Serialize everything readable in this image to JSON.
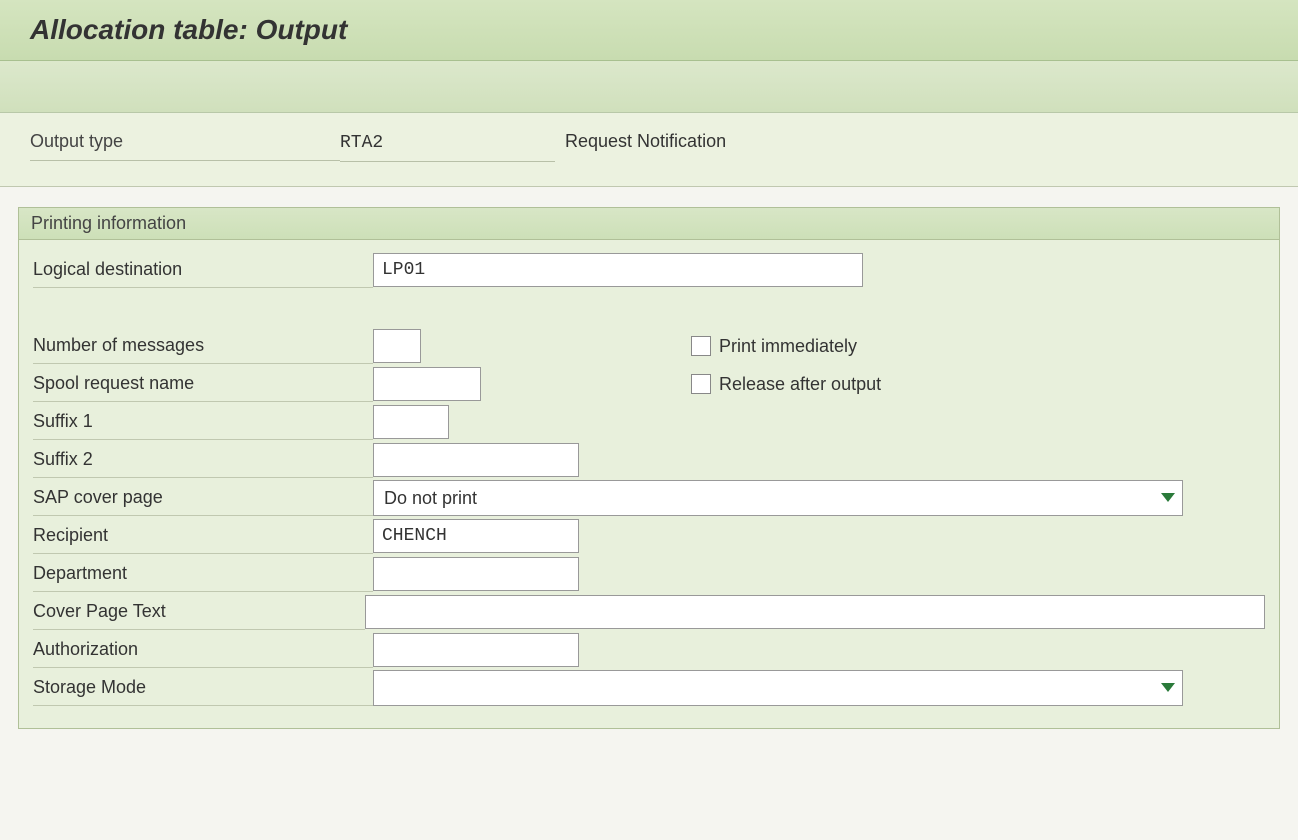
{
  "header": {
    "title": "Allocation table: Output"
  },
  "info": {
    "output_type_label": "Output type",
    "output_type_value": "RTA2",
    "output_type_desc": "Request Notification"
  },
  "group": {
    "title": "Printing information",
    "fields": {
      "logical_destination_label": "Logical destination",
      "logical_destination_value": "LP01",
      "number_of_messages_label": "Number of messages",
      "number_of_messages_value": "",
      "print_immediately_label": "Print immediately",
      "spool_request_name_label": "Spool request name",
      "spool_request_name_value": "",
      "release_after_output_label": "Release after output",
      "suffix1_label": "Suffix 1",
      "suffix1_value": "",
      "suffix2_label": "Suffix 2",
      "suffix2_value": "",
      "sap_cover_page_label": "SAP cover page",
      "sap_cover_page_value": "Do not print",
      "recipient_label": "Recipient",
      "recipient_value": "CHENCH",
      "department_label": "Department",
      "department_value": "",
      "cover_page_text_label": "Cover Page Text",
      "cover_page_text_value": "",
      "authorization_label": "Authorization",
      "authorization_value": "",
      "storage_mode_label": "Storage Mode",
      "storage_mode_value": ""
    }
  }
}
